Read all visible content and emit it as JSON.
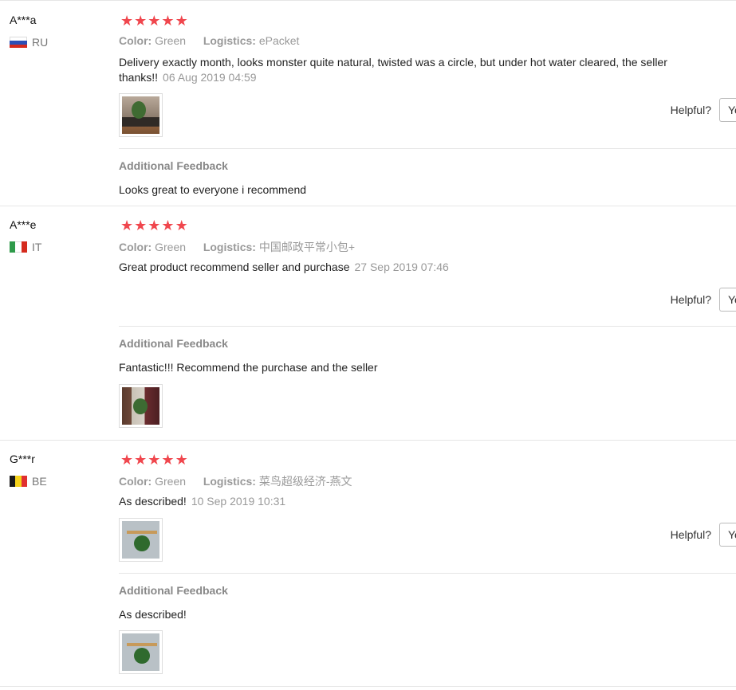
{
  "reviews": [
    {
      "user": "A***a",
      "country": "RU",
      "flag": [
        "#ffffff",
        "#2d4fb6",
        "#d52b1e"
      ],
      "rating": 5,
      "color_label": "Color:",
      "color_value": "Green",
      "logistics_label": "Logistics:",
      "logistics_value": "ePacket",
      "text": "Delivery exactly month, looks monster quite natural, twisted was a circle, but under hot water cleared, the seller thanks!!",
      "date": "06 Aug 2019 04:59",
      "helpful_label": "Helpful?",
      "helpful_yes": "Yes",
      "additional_title": "Additional Feedback",
      "additional_text": "Looks great to everyone i recommend"
    },
    {
      "user": "A***e",
      "country": "IT",
      "flag": [
        "#2e9a4a",
        "#ffffff",
        "#d52b1e"
      ],
      "rating": 5,
      "color_label": "Color:",
      "color_value": "Green",
      "logistics_label": "Logistics:",
      "logistics_value": "中国邮政平常小包+",
      "text": "Great product recommend seller and purchase",
      "date": "27 Sep 2019 07:46",
      "helpful_label": "Helpful?",
      "helpful_yes": "Yes",
      "additional_title": "Additional Feedback",
      "additional_text": "Fantastic!!! Recommend the purchase and the seller"
    },
    {
      "user": "G***r",
      "country": "BE",
      "flag": [
        "#1a1a1a",
        "#f5d21b",
        "#e03030"
      ],
      "rating": 5,
      "color_label": "Color:",
      "color_value": "Green",
      "logistics_label": "Logistics:",
      "logistics_value": "菜鸟超级经济-燕文",
      "text": "As described!",
      "date": "10 Sep 2019 10:31",
      "helpful_label": "Helpful?",
      "helpful_yes": "Yes",
      "additional_title": "Additional Feedback",
      "additional_text": "As described!"
    }
  ]
}
